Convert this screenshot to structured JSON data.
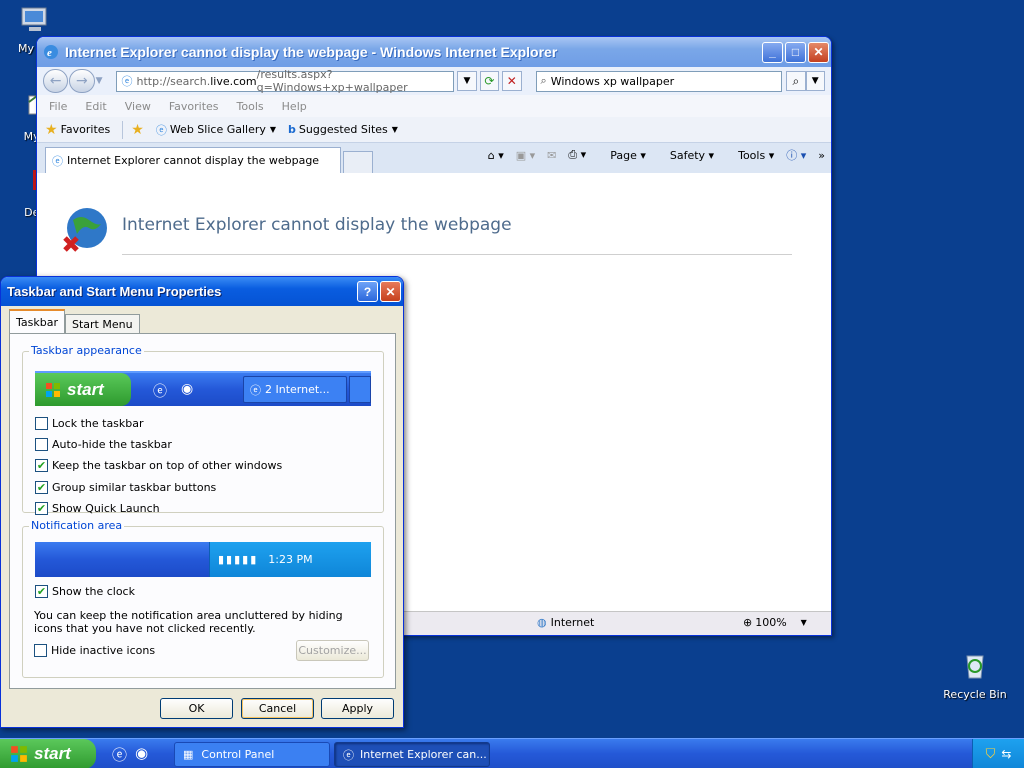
{
  "desktop": {
    "icons": [
      {
        "label": "My Co"
      },
      {
        "label": "MyP"
      },
      {
        "label": "Dev"
      },
      {
        "label": ""
      }
    ],
    "recycle_bin": "Recycle Bin"
  },
  "ie": {
    "title": "Internet Explorer cannot display the webpage - Windows Internet Explorer",
    "address_prefix": "http://search.",
    "address_domain": "live.com",
    "address_suffix": "/results.aspx?q=Windows+xp+wallpaper",
    "search_value": "Windows xp wallpaper",
    "menu": [
      "File",
      "Edit",
      "View",
      "Favorites",
      "Tools",
      "Help"
    ],
    "favorites_label": "Favorites",
    "web_slice": "Web Slice Gallery",
    "suggested": "Suggested Sites",
    "tab_title": "Internet Explorer cannot display the webpage",
    "cmd": {
      "page": "Page",
      "safety": "Safety",
      "tools": "Tools"
    },
    "error_heading": "Internet Explorer cannot display the webpage",
    "status_zone": "Internet",
    "zoom": "100%"
  },
  "dialog": {
    "title": "Taskbar and Start Menu Properties",
    "tabs": [
      "Taskbar",
      "Start Menu"
    ],
    "appearance_legend": "Taskbar appearance",
    "preview_start": "start",
    "preview_task": "2 Internet...",
    "options": [
      {
        "label": "Lock the taskbar",
        "checked": false
      },
      {
        "label": "Auto-hide the taskbar",
        "checked": false
      },
      {
        "label": "Keep the taskbar on top of other windows",
        "checked": true
      },
      {
        "label": "Group similar taskbar buttons",
        "checked": true
      },
      {
        "label": "Show Quick Launch",
        "checked": true
      }
    ],
    "notification_legend": "Notification area",
    "preview_clock": "1:23 PM",
    "show_clock": "Show the clock",
    "info": "You can keep the notification area uncluttered by hiding icons that you have not clicked recently.",
    "hide_inactive": "Hide inactive icons",
    "customize": "Customize...",
    "ok": "OK",
    "cancel": "Cancel",
    "apply": "Apply"
  },
  "taskbar": {
    "start": "start",
    "tasks": [
      "Control Panel",
      "Internet Explorer can..."
    ]
  }
}
